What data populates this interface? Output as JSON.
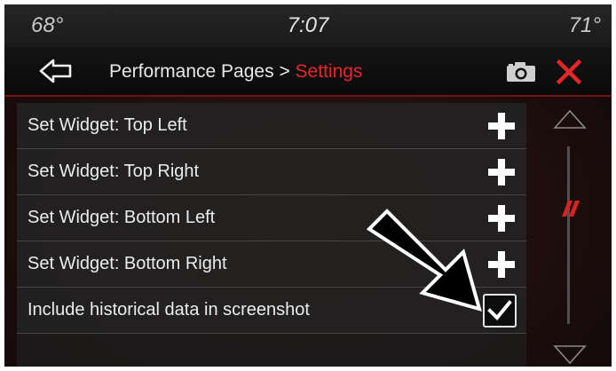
{
  "status": {
    "outside_temp": "68°",
    "time": "7:07",
    "inside_temp": "71°"
  },
  "header": {
    "breadcrumb_parent": "Performance Pages",
    "breadcrumb_separator": " > ",
    "breadcrumb_current": "Settings",
    "back_icon": "back-arrow-icon",
    "camera_icon": "camera-icon",
    "close_icon": "close-icon"
  },
  "settings": {
    "rows": [
      {
        "label": "Set Widget: Top Left",
        "control": "plus"
      },
      {
        "label": "Set Widget: Top Right",
        "control": "plus"
      },
      {
        "label": "Set Widget: Bottom Left",
        "control": "plus"
      },
      {
        "label": "Set Widget: Bottom Right",
        "control": "plus"
      },
      {
        "label": "Include historical data in screenshot",
        "control": "checkbox",
        "checked": true
      }
    ]
  },
  "colors": {
    "accent_red": "#e8262a",
    "text": "#ececec",
    "row_bg": "#222222"
  }
}
